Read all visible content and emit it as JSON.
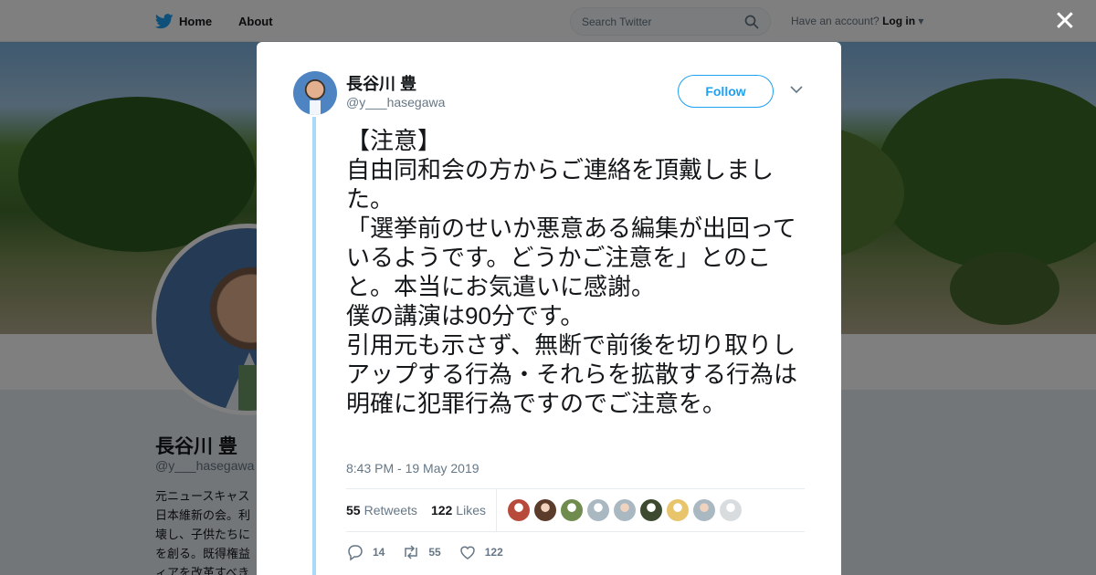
{
  "topbar": {
    "home_label": "Home",
    "about_label": "About",
    "search_placeholder": "Search Twitter",
    "account_prompt": "Have an account?",
    "login_label": "Log in"
  },
  "profile": {
    "name": "長谷川 豊",
    "handle": "@y___hasegawa",
    "bio_visible": "元ニュースキャス\n日本維新の会。利\n壊し、子供たちに\nを創る。既得権益\nィアを改革すべき"
  },
  "tweet": {
    "author_name": "長谷川 豊",
    "author_handle": "@y___hasegawa",
    "follow_label": "Follow",
    "text": "【注意】\n自由同和会の方からご連絡を頂戴しました。\n「選挙前のせいか悪意ある編集が出回っているようです。どうかご注意を」とのこと。本当にお気遣いに感謝。\n僕の講演は90分です。\n引用元も示さず、無断で前後を切り取りしアップする行為・それらを拡散する行為は明確に犯罪行為ですのでご注意を。",
    "timestamp": "8:43 PM - 19 May 2019",
    "retweets_count": "55",
    "retweets_label": "Retweets",
    "likes_count": "122",
    "likes_label": "Likes",
    "liker_avatar_colors": [
      "#b84a3c",
      "#5b3b2a",
      "#6f8c4e",
      "#aab8c2",
      "#aab8c2",
      "#3e4a30",
      "#e8c46a",
      "#aab8c2",
      "#d9dcde"
    ],
    "actions": {
      "reply_count": "14",
      "retweet_count": "55",
      "like_count": "122"
    }
  },
  "colors": {
    "brand": "#1da1f2",
    "thread_line": "#a8d9f5",
    "secondary_text": "#657786"
  }
}
